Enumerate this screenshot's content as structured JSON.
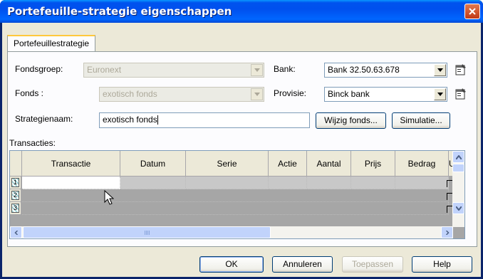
{
  "window": {
    "title": "Portefeuille-strategie eigenschappen"
  },
  "tab": {
    "label": "Portefeuillestrategie"
  },
  "form": {
    "fondsgroep_label": "Fondsgroep:",
    "fondsgroep_value": "Euronext",
    "fonds_label": "Fonds :",
    "fonds_value": "exotisch fonds",
    "strategienaam_label": "Strategienaam:",
    "strategienaam_value": "exotisch fonds",
    "bank_label": "Bank:",
    "bank_value": "Bank 32.50.63.678",
    "provisie_label": "Provisie:",
    "provisie_value": "Binck bank",
    "wijzig_label": "Wijzig fonds...",
    "simulatie_label": "Simulatie..."
  },
  "grid": {
    "caption": "Transacties:",
    "columns": [
      "Transactie",
      "Datum",
      "Serie",
      "Actie",
      "Aantal",
      "Prijs",
      "Bedrag",
      "U"
    ],
    "rows": [
      "1",
      "2",
      "3"
    ]
  },
  "footer": {
    "ok": "OK",
    "annuleren": "Annuleren",
    "toepassen": "Toepassen",
    "help": "Help"
  },
  "icons": {
    "close": "close-icon",
    "combo": "chevron-down-icon",
    "properties": "properties-icon",
    "cursor": "mouse-cursor-icon"
  },
  "colors": {
    "title_bar": "#0053ee",
    "close_button": "#c13a16",
    "scroll": "#c1d3fb",
    "face": "#ece9d8"
  }
}
